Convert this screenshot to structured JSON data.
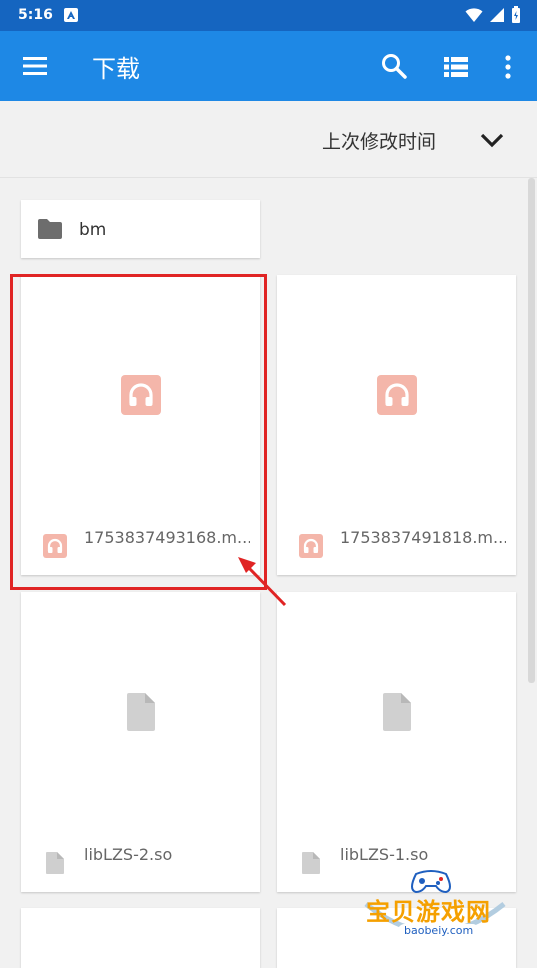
{
  "status_bar": {
    "time": "5:16",
    "app_badge": "A"
  },
  "app_bar": {
    "title": "下载",
    "icons": [
      "menu-icon",
      "search-icon",
      "list-view-icon",
      "more-vert-icon"
    ]
  },
  "sort": {
    "label": "上次修改时间",
    "icon": "chevron-down-icon"
  },
  "folder": {
    "name": "bm",
    "icon": "folder-icon"
  },
  "files": [
    {
      "name": "1753837493168.m...",
      "type": "audio",
      "icon": "headphones-icon",
      "accent": "#f4b6aa"
    },
    {
      "name": "1753837491818.m...",
      "type": "audio",
      "icon": "headphones-icon",
      "accent": "#f4b6aa"
    },
    {
      "name": "libLZS-2.so",
      "type": "file",
      "icon": "document-icon",
      "accent": "#cccccc"
    },
    {
      "name": "libLZS-1.so",
      "type": "file",
      "icon": "document-icon",
      "accent": "#cccccc"
    }
  ],
  "watermark": {
    "text": "宝贝游戏网",
    "url": "baobeiy.com"
  },
  "colors": {
    "status_bar": "#1565c0",
    "app_bar": "#1e88e5",
    "highlight": "#e02424"
  }
}
